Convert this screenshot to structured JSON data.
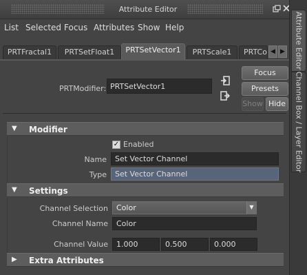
{
  "window": {
    "title": "Attribute Editor"
  },
  "menu": [
    "List",
    "Selected",
    "Focus",
    "Attributes",
    "Show",
    "Help"
  ],
  "tabs": [
    "PRTFractal1",
    "PRTSetFloat1",
    "PRTSetVector1",
    "PRTScale1",
    "PRTCo"
  ],
  "active_tab_index": 2,
  "node": {
    "label": "PRTModifier:",
    "value": "PRTSetVector1"
  },
  "buttons": {
    "focus": "Focus",
    "presets": "Presets",
    "show": "Show",
    "hide": "Hide"
  },
  "sections": {
    "modifier": {
      "title": "Modifier",
      "enabled_label": "Enabled",
      "enabled": true,
      "name_label": "Name",
      "name_value": "Set Vector Channel",
      "type_label": "Type",
      "type_value": "Set Vector Channel"
    },
    "settings": {
      "title": "Settings",
      "channel_selection_label": "Channel Selection",
      "channel_selection_value": "Color",
      "channel_name_label": "Channel Name",
      "channel_name_value": "Color",
      "channel_value_label": "Channel Value",
      "channel_value": [
        "1.000",
        "0.500",
        "0.000"
      ]
    },
    "extra": {
      "title": "Extra Attributes"
    }
  },
  "side_tabs": [
    "Attribute Editor",
    "Channel Box / Layer Editor"
  ],
  "icons": {
    "float": "float-window-icon",
    "close": "close-icon",
    "tab_left": "chevron-left-icon",
    "tab_right": "chevron-right-icon",
    "input_conn": "input-connection-icon",
    "output_conn": "output-connection-icon",
    "expanded": "triangle-down-icon",
    "collapsed": "triangle-right-icon",
    "dropdown": "chevron-down-icon",
    "check": "checkmark-icon"
  },
  "colors": {
    "panel_bg": "#444444",
    "header_bg": "#5d5d5d",
    "field_bg": "#2b2b2b",
    "highlight_field": "#58647a"
  }
}
